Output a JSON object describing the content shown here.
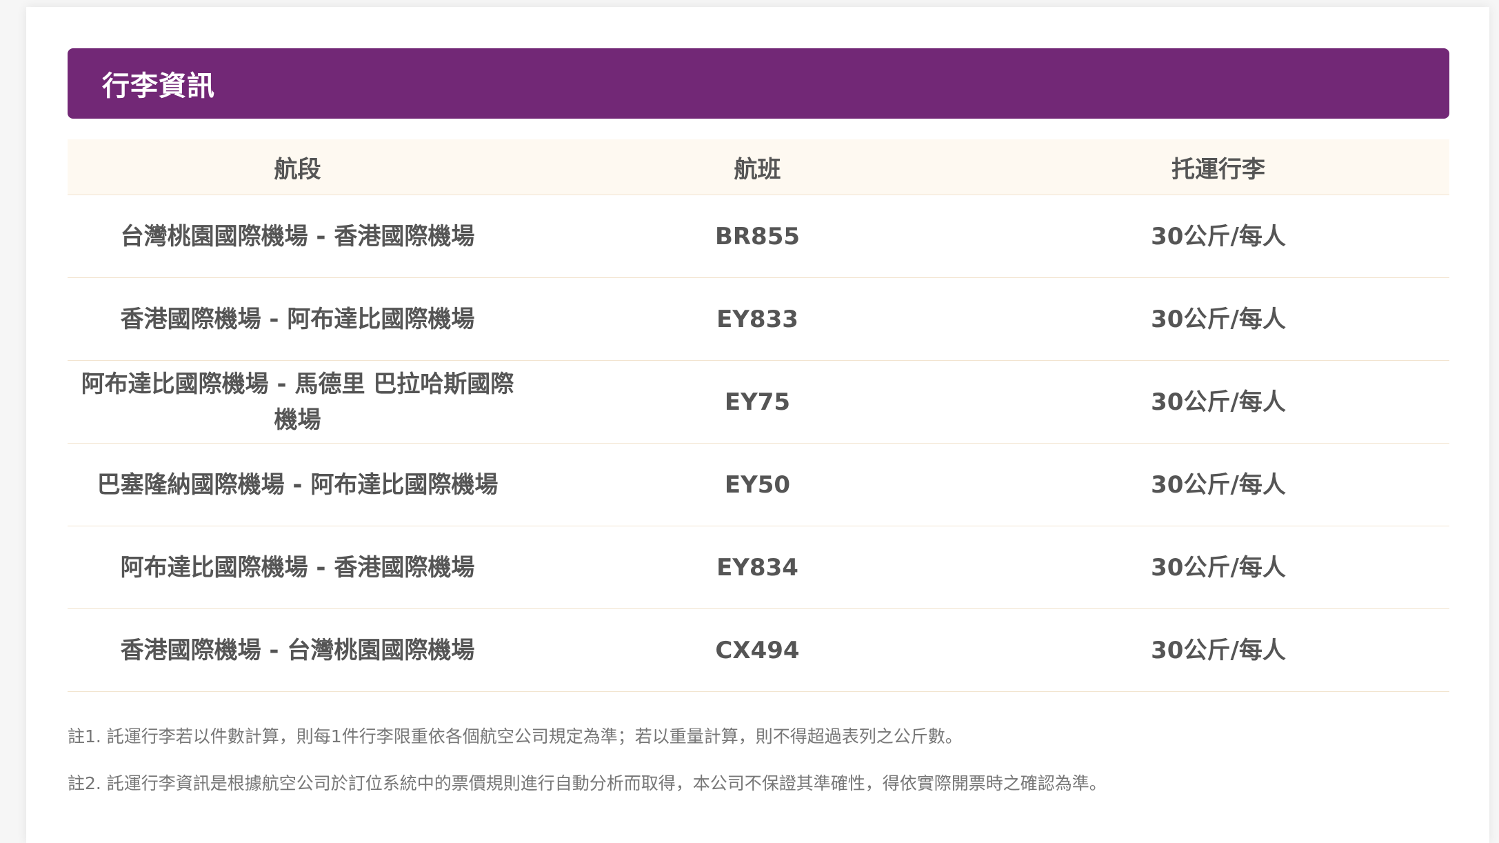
{
  "header": {
    "title": "行李資訊"
  },
  "table": {
    "columns": [
      "航段",
      "航班",
      "托運行李"
    ],
    "rows": [
      {
        "segment": "台灣桃園國際機場 - 香港國際機場",
        "flight": "BR855",
        "baggage": "30公斤/每人"
      },
      {
        "segment": "香港國際機場 - 阿布達比國際機場",
        "flight": "EY833",
        "baggage": "30公斤/每人"
      },
      {
        "segment": "阿布達比國際機場 - 馬德里 巴拉哈斯國際機場",
        "flight": "EY75",
        "baggage": "30公斤/每人"
      },
      {
        "segment": "巴塞隆納國際機場 - 阿布達比國際機場",
        "flight": "EY50",
        "baggage": "30公斤/每人"
      },
      {
        "segment": "阿布達比國際機場 - 香港國際機場",
        "flight": "EY834",
        "baggage": "30公斤/每人"
      },
      {
        "segment": "香港國際機場 - 台灣桃園國際機場",
        "flight": "CX494",
        "baggage": "30公斤/每人"
      }
    ]
  },
  "notes": [
    "註1. 託運行李若以件數計算，則每1件行李限重依各個航空公司規定為準；若以重量計算，則不得超過表列之公斤數。",
    "註2. 託運行李資訊是根據航空公司於訂位系統中的票價規則進行自動分析而取得，本公司不保證其準確性，得依實際開票時之確認為準。"
  ],
  "colors": {
    "header_bg": "#722876",
    "table_head_bg": "#fef9f1",
    "row_border": "#f2e4cf"
  }
}
